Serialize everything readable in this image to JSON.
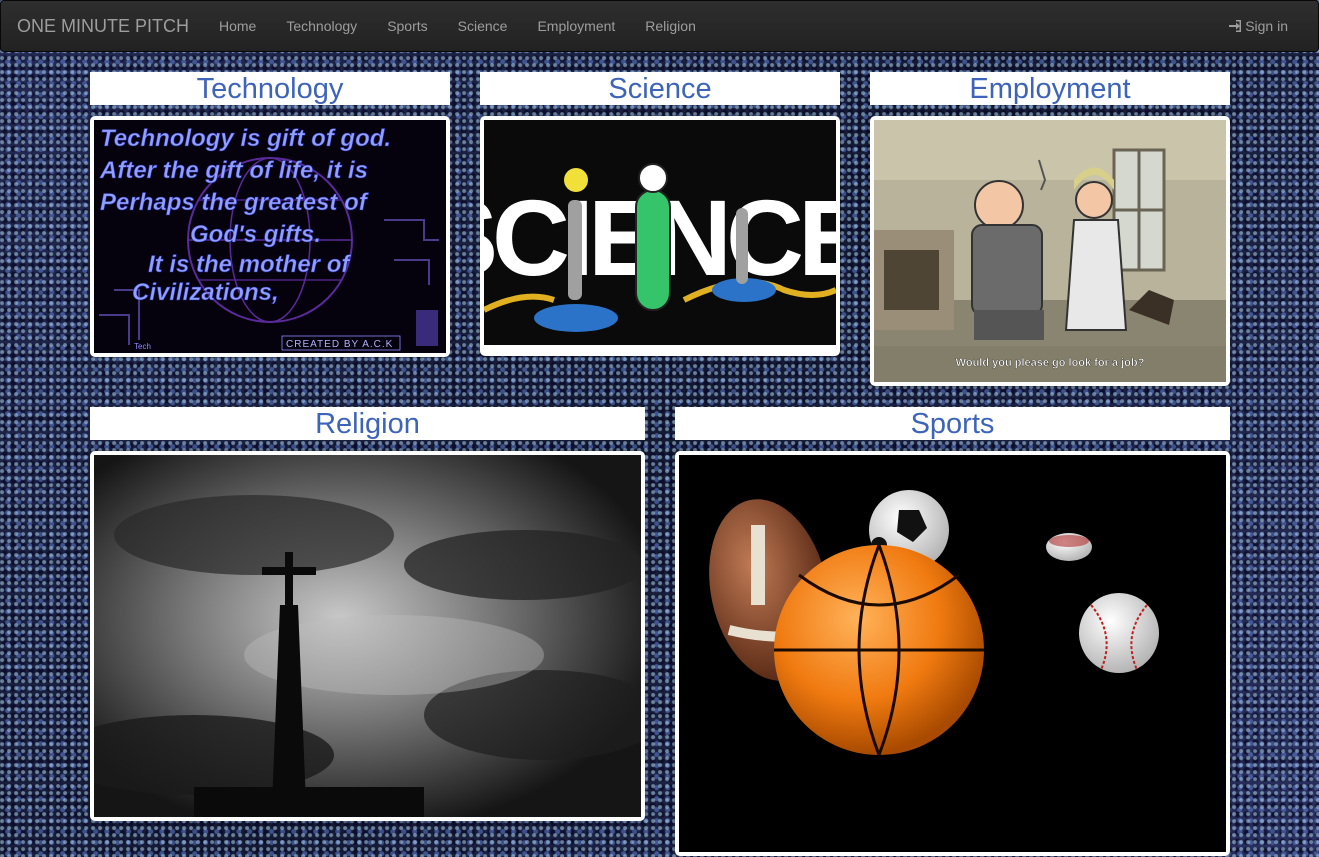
{
  "navbar": {
    "brand": "ONE MINUTE PITCH",
    "items": [
      {
        "label": "Home"
      },
      {
        "label": "Technology"
      },
      {
        "label": "Sports"
      },
      {
        "label": "Science"
      },
      {
        "label": "Employment"
      },
      {
        "label": "Religion"
      }
    ],
    "signin_label": "Sign in",
    "signin_icon": "sign-in-icon"
  },
  "categories": {
    "technology": {
      "title": "Technology",
      "image_text": [
        "Technology is gift of god.",
        "After the gift of life, it is",
        "Perhaps the greatest of",
        "God's gifts.",
        "It is the mother of",
        "Civilizations,"
      ],
      "credit": "CREATED BY A.C.K",
      "tag": "Tech"
    },
    "science": {
      "title": "Science",
      "image_text": "SCIENCE!"
    },
    "employment": {
      "title": "Employment",
      "subtitle": "Would you please go look for a job?"
    },
    "religion": {
      "title": "Religion"
    },
    "sports": {
      "title": "Sports"
    }
  },
  "colors": {
    "navbar_bg": "#222222",
    "nav_text": "#9d9d9d",
    "title_text": "#3d64b8",
    "page_bg": "#1b2140"
  }
}
